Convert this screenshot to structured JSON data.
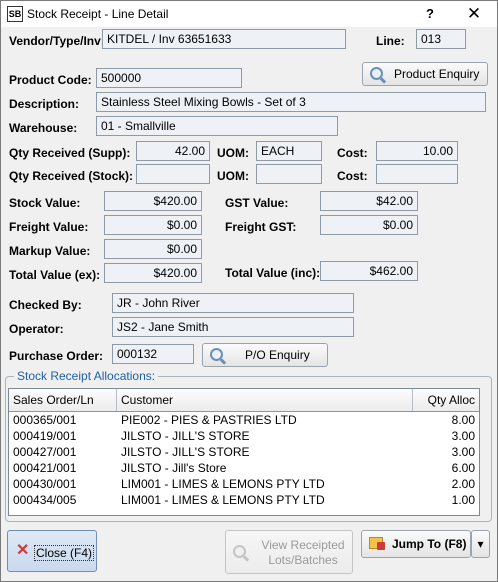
{
  "window": {
    "title": "Stock Receipt - Line Detail",
    "help_glyph": "?",
    "close_glyph": "✕",
    "icon_text": "SB"
  },
  "header": {
    "vendor_label": "Vendor/Type/Inv:",
    "vendor_value": "KITDEL / Inv 63651633",
    "line_label": "Line:",
    "line_value": "013"
  },
  "product": {
    "code_label": "Product Code:",
    "code_value": "500000",
    "enquiry_button": "Product Enquiry",
    "description_label": "Description:",
    "description_value": "Stainless Steel Mixing Bowls - Set of 3",
    "warehouse_label": "Warehouse:",
    "warehouse_value": "01 - Smallville"
  },
  "qty": {
    "supp_label": "Qty Received (Supp):",
    "supp_value": "42.00",
    "uom_label": "UOM:",
    "uom_supp_value": "EACH",
    "cost_label": "Cost:",
    "cost_supp_value": "10.00",
    "stock_label": "Qty Received (Stock):",
    "stock_value": "",
    "uom_stock_value": "",
    "cost_stock_value": ""
  },
  "values": {
    "stock_value_label": "Stock Value:",
    "stock_value": "$420.00",
    "gst_value_label": "GST Value:",
    "gst_value": "$42.00",
    "freight_value_label": "Freight Value:",
    "freight_value": "$0.00",
    "freight_gst_label": "Freight GST:",
    "freight_gst": "$0.00",
    "markup_value_label": "Markup Value:",
    "markup_value": "$0.00",
    "total_ex_label": "Total Value (ex):",
    "total_ex": "$420.00",
    "total_inc_label": "Total Value (inc):",
    "total_inc": "$462.00"
  },
  "people": {
    "checked_by_label": "Checked By:",
    "checked_by_value": "JR - John River",
    "operator_label": "Operator:",
    "operator_value": "JS2 - Jane Smith",
    "po_label": "Purchase Order:",
    "po_value": "000132",
    "po_enquiry_button": "P/O Enquiry"
  },
  "allocations": {
    "title": "Stock Receipt Allocations:",
    "columns": [
      "Sales Order/Ln",
      "Customer",
      "Qty Alloc"
    ],
    "rows": [
      {
        "order": "000365/001",
        "customer": "PIE002 - PIES & PASTRIES LTD",
        "qty": "8.00"
      },
      {
        "order": "000419/001",
        "customer": "JILSTO - JILL'S STORE",
        "qty": "3.00"
      },
      {
        "order": "000427/001",
        "customer": "JILSTO - JILL'S STORE",
        "qty": "3.00"
      },
      {
        "order": "000421/001",
        "customer": "JILSTO - Jill's Store",
        "qty": "6.00"
      },
      {
        "order": "000430/001",
        "customer": "LIM001 - LIMES & LEMONS PTY LTD",
        "qty": "2.00"
      },
      {
        "order": "000434/005",
        "customer": "LIM001 - LIMES & LEMONS PTY LTD",
        "qty": "1.00"
      }
    ]
  },
  "footer": {
    "close_button": "Close (F4)",
    "view_lots_line1": "View Receipted",
    "view_lots_line2": "Lots/Batches",
    "jump_button": "Jump To (F8)",
    "dropdown_glyph": "▾"
  },
  "colors": {
    "accent": "#1f5fa8",
    "field_bg": "#eef2f6",
    "close_icon": "#d03a3a",
    "jump_icon": "#e0a020"
  }
}
